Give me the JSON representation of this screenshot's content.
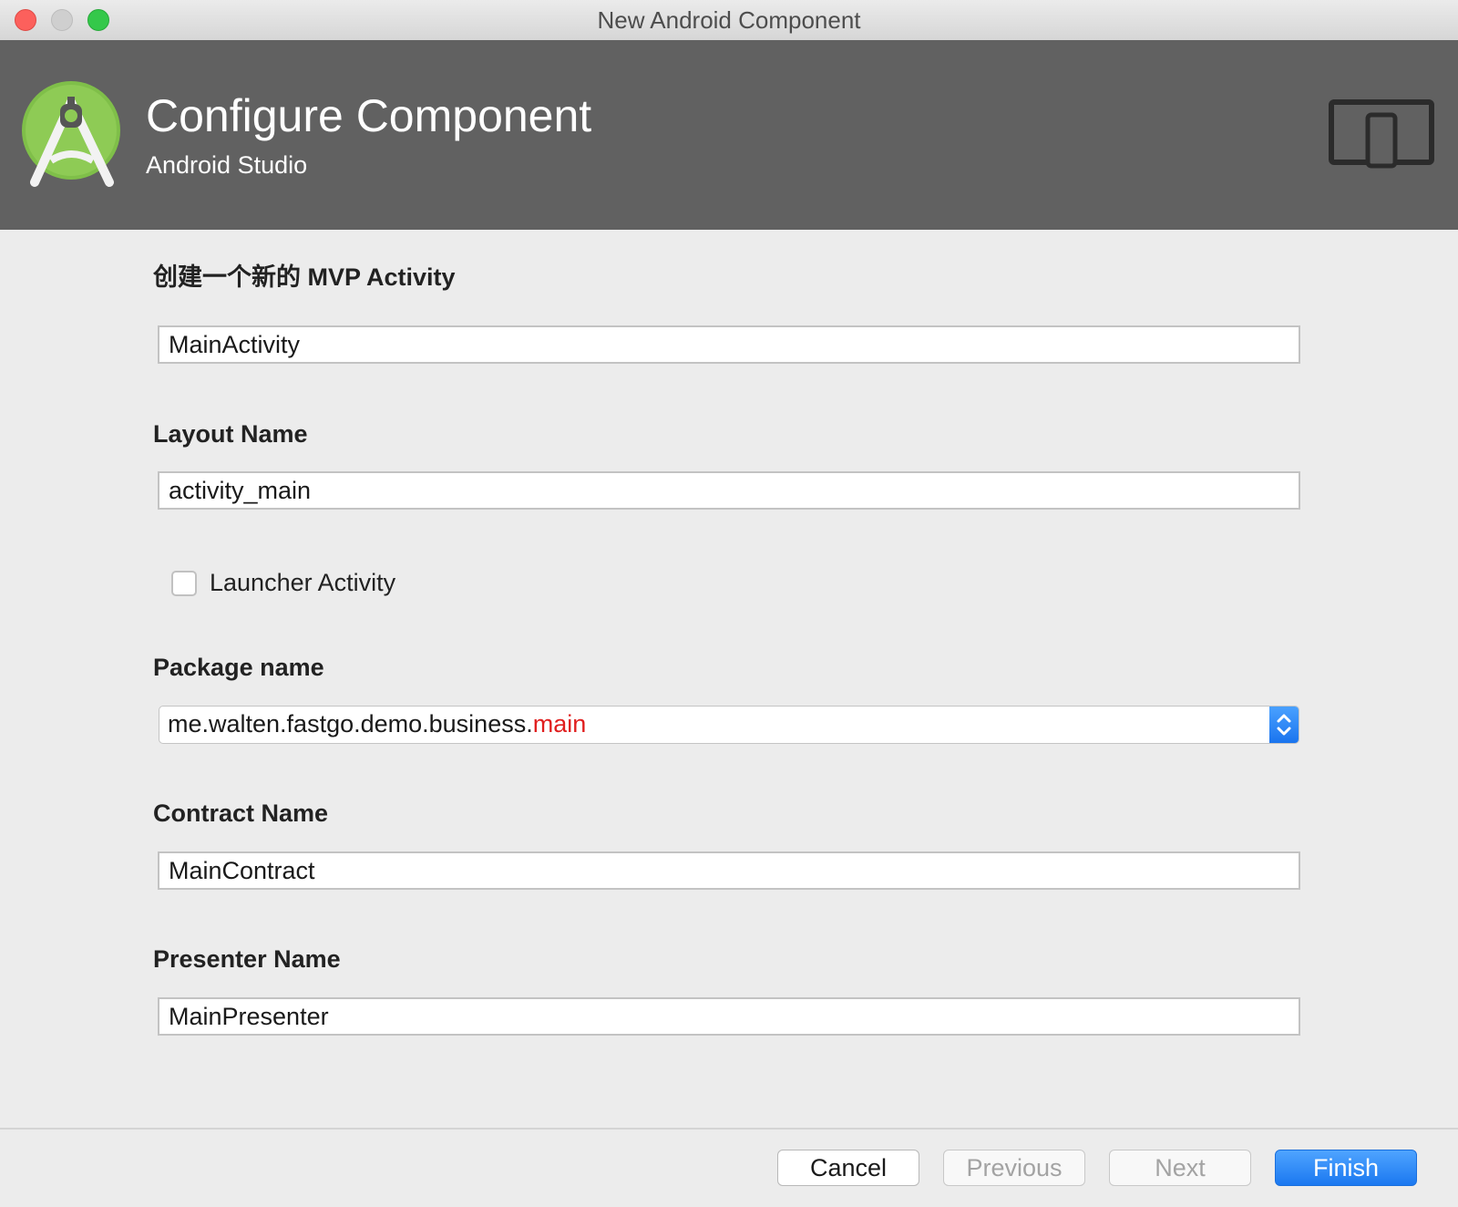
{
  "window": {
    "title": "New Android Component"
  },
  "header": {
    "title": "Configure Component",
    "subtitle": "Android Studio",
    "logo_icon": "android-studio-logo-icon",
    "device_icon": "tablet-phone-device-icon",
    "background_color": "#616161"
  },
  "form": {
    "activity": {
      "label": "创建一个新的 MVP Activity",
      "value": "MainActivity"
    },
    "layout": {
      "label": "Layout Name",
      "value": "activity_main"
    },
    "launcher": {
      "label": "Launcher Activity",
      "checked": false
    },
    "package": {
      "label": "Package name",
      "value_prefix": "me.walten.fastgo.demo.business.",
      "value_highlight": "main",
      "highlight_color": "#e01e1e"
    },
    "contract": {
      "label": "Contract Name",
      "value": "MainContract"
    },
    "presenter": {
      "label": "Presenter Name",
      "value": "MainPresenter"
    }
  },
  "footer": {
    "cancel_label": "Cancel",
    "previous_label": "Previous",
    "next_label": "Next",
    "finish_label": "Finish",
    "primary_color": "#1b78f0"
  }
}
